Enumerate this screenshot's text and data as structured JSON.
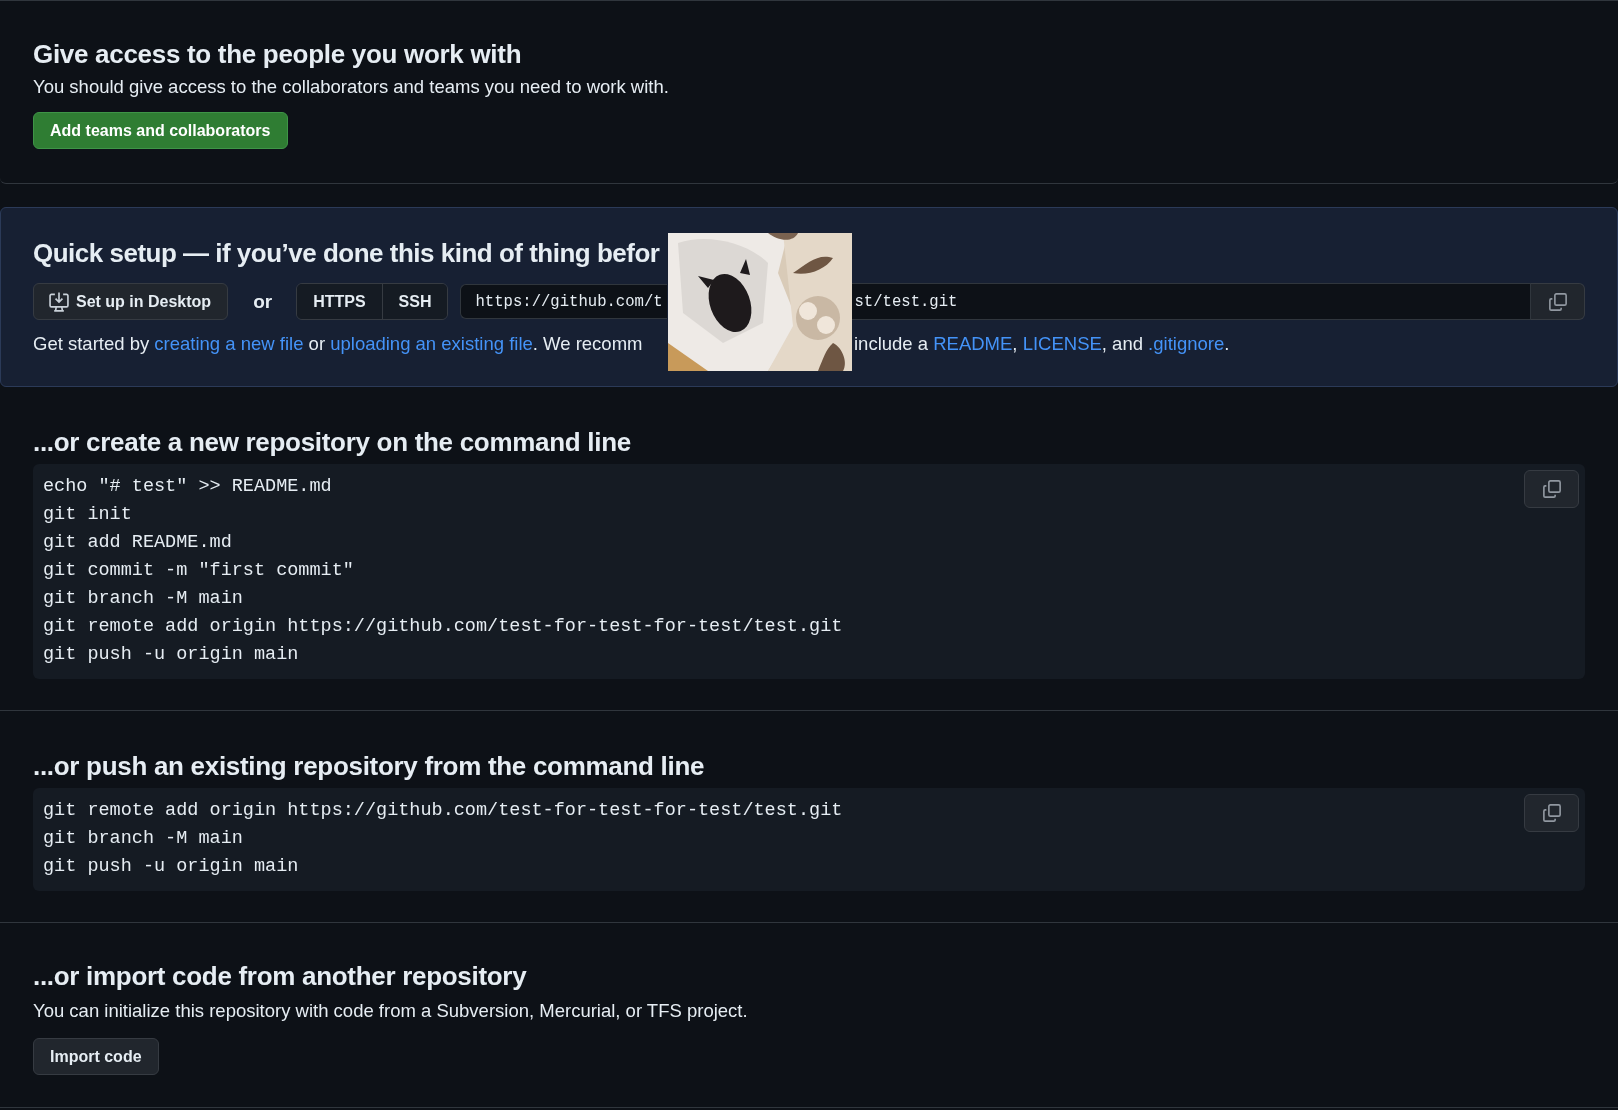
{
  "access": {
    "title": "Give access to the people you work with",
    "text": "You should give access to the collaborators and teams you need to work with.",
    "button": "Add teams and collaborators"
  },
  "quick_setup": {
    "title": "Quick setup — if you’ve done this kind of thing befor",
    "desktop_button": "Set up in Desktop",
    "or": "or",
    "protocols": [
      "HTTPS",
      "SSH"
    ],
    "url_start": "https://github.com/t",
    "url_end": "st/test.git",
    "intro_start": [
      {
        "kind": "text",
        "text": "Get started by "
      },
      {
        "kind": "link",
        "text": "creating a new file"
      },
      {
        "kind": "text",
        "text": " or "
      },
      {
        "kind": "link",
        "text": "uploading an existing file"
      },
      {
        "kind": "text",
        "text": ". We recomm"
      }
    ],
    "intro_end": [
      {
        "kind": "text",
        "text": "include a "
      },
      {
        "kind": "link",
        "text": "README"
      },
      {
        "kind": "text",
        "text": ", "
      },
      {
        "kind": "link",
        "text": "LICENSE"
      },
      {
        "kind": "text",
        "text": ", and "
      },
      {
        "kind": "link",
        "text": ".gitignore"
      },
      {
        "kind": "text",
        "text": "."
      }
    ],
    "picture": {
      "kind": "picture"
    }
  },
  "command_sections": [
    {
      "title": "...or create a new repository on the command line",
      "lines": [
        "echo \"# test\" >> README.md",
        "git init",
        "git add README.md",
        "git commit -m \"first commit\"",
        "git branch -M main",
        "git remote add origin https://github.com/test-for-test-for-test/test.git",
        "git push -u origin main"
      ]
    },
    {
      "title": "...or push an existing repository from the command line",
      "lines": [
        "git remote add origin https://github.com/test-for-test-for-test/test.git",
        "git branch -M main",
        "git push -u origin main"
      ]
    }
  ],
  "import": {
    "title": "...or import code from another repository",
    "text": "You can initialize this repository with code from a Subversion, Mercurial, or TFS project.",
    "button": "Import code"
  }
}
